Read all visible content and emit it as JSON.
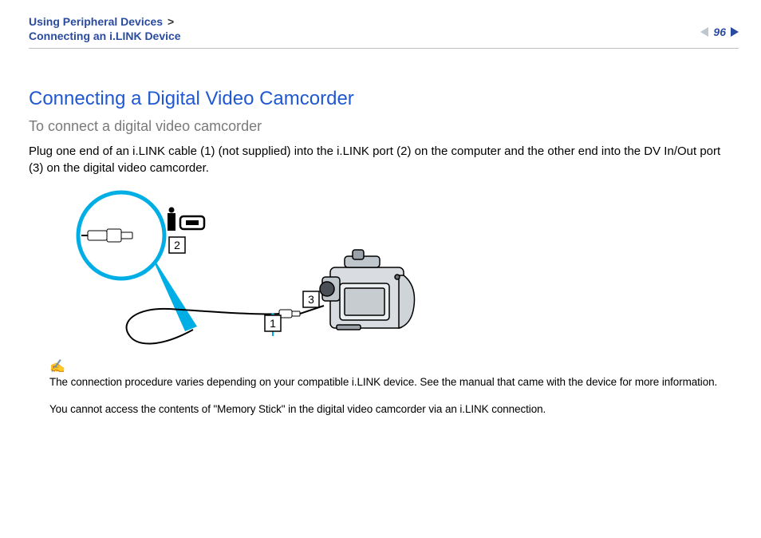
{
  "header": {
    "breadcrumb_line1": "Using Peripheral Devices",
    "breadcrumb_gt": ">",
    "breadcrumb_line2": "Connecting an i.LINK Device",
    "page_number": "96"
  },
  "content": {
    "title": "Connecting a Digital Video Camcorder",
    "subtitle": "To connect a digital video camcorder",
    "body": "Plug one end of an i.LINK cable (1) (not supplied) into the i.LINK port (2) on the computer and the other end into the DV In/Out port (3) on the digital video camcorder."
  },
  "diagram": {
    "callouts": {
      "cable": "1",
      "port": "2",
      "dv_in_out": "3"
    }
  },
  "notes": {
    "icon": "✍",
    "line1": "The connection procedure varies depending on your compatible i.LINK device. See the manual that came with the device for more information.",
    "line2": "You cannot access the contents of \"Memory Stick\" in the digital video camcorder via an i.LINK connection."
  }
}
